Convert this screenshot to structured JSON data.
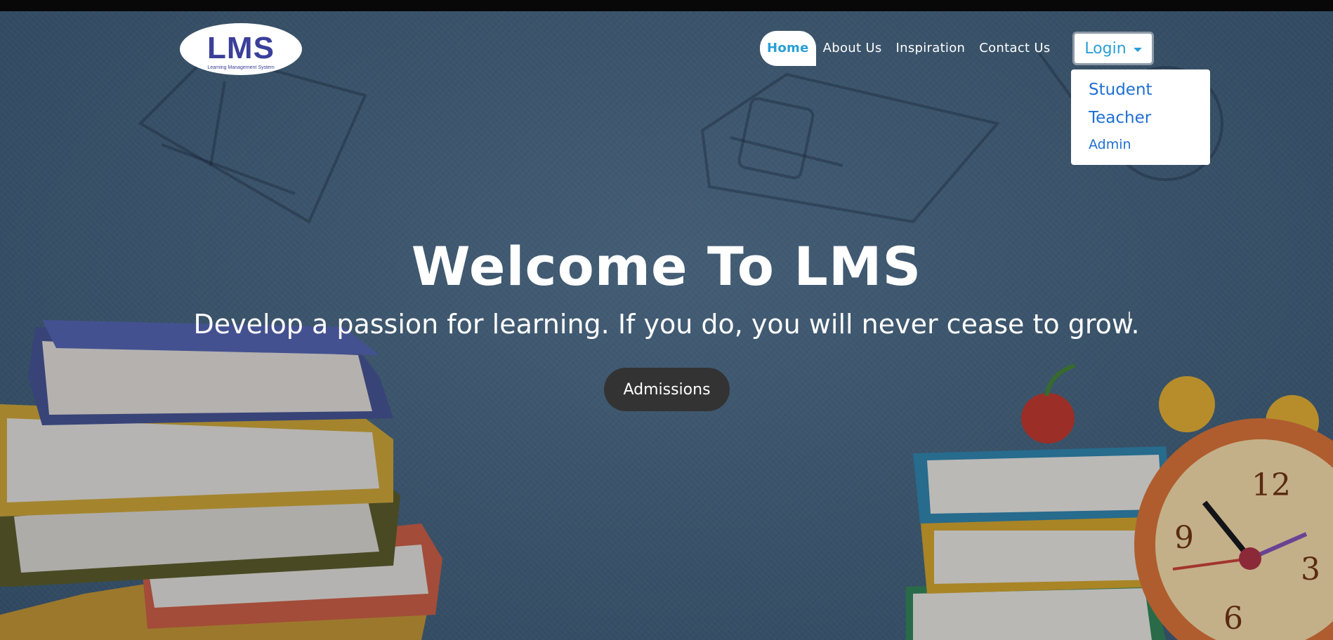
{
  "logo": {
    "text": "LMS",
    "subtitle": "Learning Management System"
  },
  "nav": {
    "items": [
      {
        "label": "Home",
        "active": true
      },
      {
        "label": "About Us"
      },
      {
        "label": "Inspiration"
      },
      {
        "label": "Contact Us"
      }
    ],
    "login_label": "Login"
  },
  "login_dropdown": {
    "items": [
      {
        "label": "Student"
      },
      {
        "label": "Teacher"
      },
      {
        "label": "Admin"
      }
    ]
  },
  "hero": {
    "title": "Welcome To LMS",
    "subtitle": "Develop a passion for learning. If you do, you will never cease to grow.",
    "cta_label": "Admissions"
  },
  "clock_numbers": [
    "12",
    "9",
    "3",
    "6"
  ],
  "colors": {
    "accent": "#2a9fd6",
    "dropdown_link": "#1f6fd1",
    "button_dark": "#333333",
    "hero_bg": "#3e5a72"
  }
}
